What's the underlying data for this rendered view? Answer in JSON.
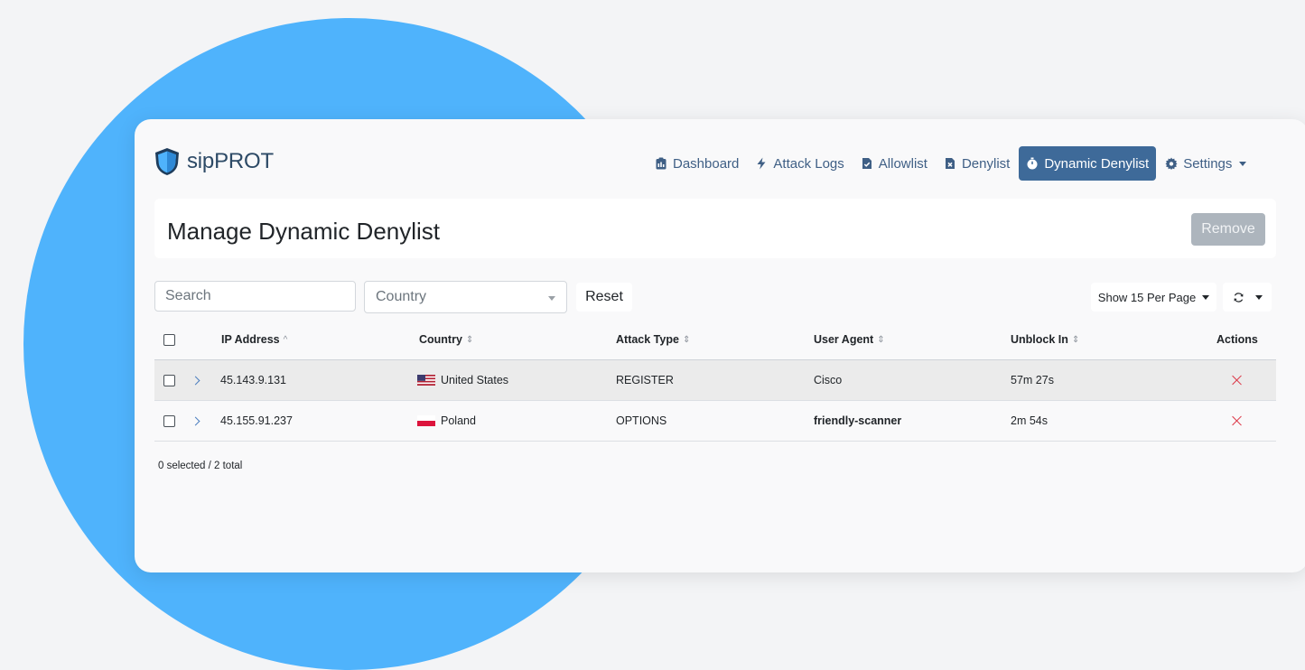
{
  "brand": {
    "name": "sipPROT"
  },
  "nav": {
    "items": [
      {
        "label": "Dashboard",
        "icon": "clipboard-icon"
      },
      {
        "label": "Attack Logs",
        "icon": "lightning-icon"
      },
      {
        "label": "Allowlist",
        "icon": "file-check-icon"
      },
      {
        "label": "Denylist",
        "icon": "file-x-icon"
      },
      {
        "label": "Dynamic Denylist",
        "icon": "stopwatch-icon",
        "active": true
      },
      {
        "label": "Settings",
        "icon": "gear-icon"
      }
    ]
  },
  "header": {
    "title": "Manage Dynamic Denylist",
    "remove_label": "Remove"
  },
  "filters": {
    "search_placeholder": "Search",
    "country_placeholder": "Country",
    "reset_label": "Reset",
    "per_page_label": "Show 15 Per Page"
  },
  "table": {
    "columns": [
      "IP Address",
      "Country",
      "Attack Type",
      "User Agent",
      "Unblock In",
      "Actions"
    ],
    "rows": [
      {
        "ip": "45.143.9.131",
        "country": "United States",
        "flag": "us",
        "attack_type": "REGISTER",
        "user_agent": "Cisco",
        "unblock_in": "57m 27s"
      },
      {
        "ip": "45.155.91.237",
        "country": "Poland",
        "flag": "pl",
        "attack_type": "OPTIONS",
        "user_agent": "friendly-scanner",
        "unblock_in": "2m 54s"
      }
    ]
  },
  "summary": "0 selected / 2 total",
  "colors": {
    "background": "#f3f4f6",
    "accent_blob": "#4fb3fc",
    "nav_active": "#3e6a99",
    "brand_text": "#2d4a66",
    "remove_disabled": "#adb5bd",
    "delete_x": "#dc3545"
  }
}
